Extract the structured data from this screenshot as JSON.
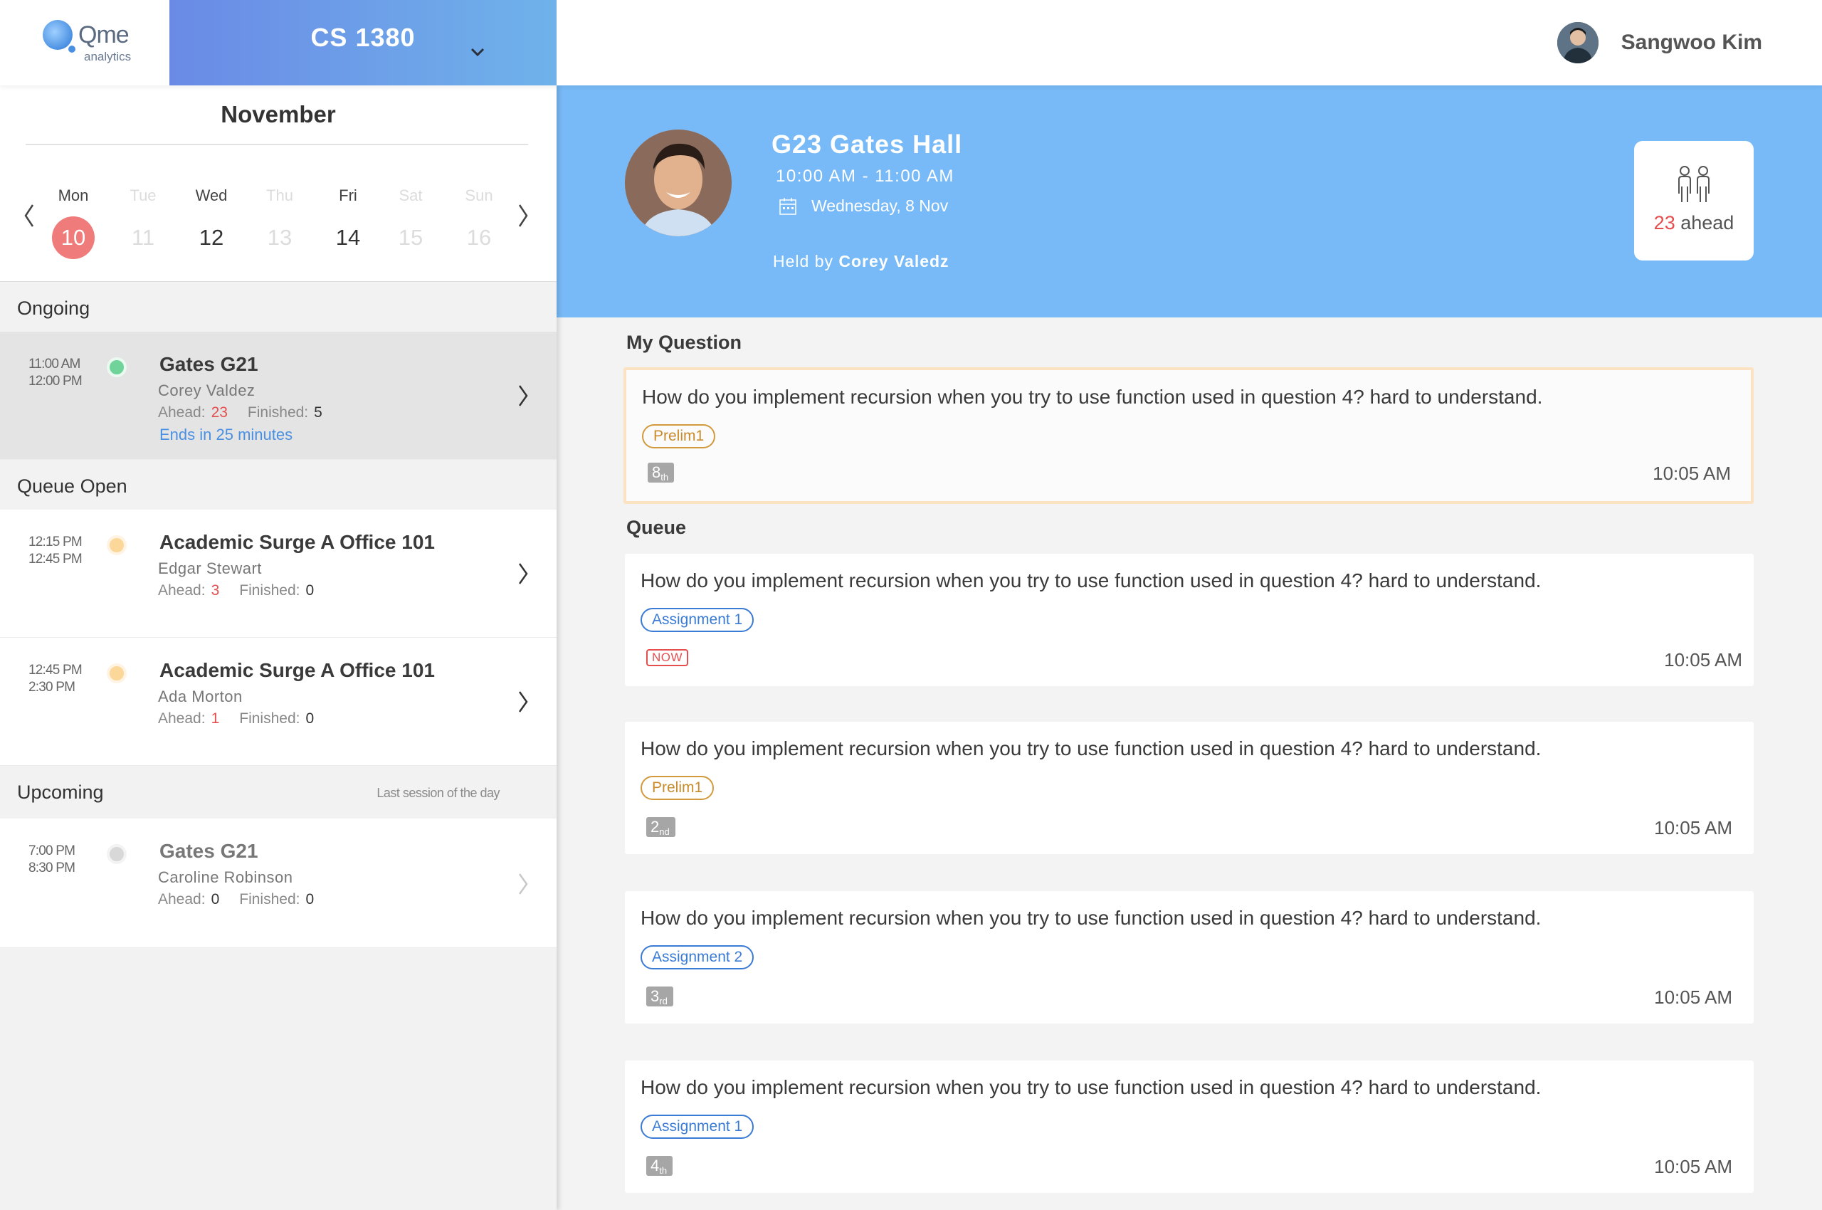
{
  "header": {
    "logo_text": "Qme",
    "logo_sub": "analytics",
    "course": "CS 1380",
    "user_name": "Sangwoo Kim"
  },
  "calendar": {
    "month": "November",
    "days": [
      {
        "name": "Mon",
        "date": "10",
        "state": "selected"
      },
      {
        "name": "Tue",
        "date": "11",
        "state": "disabled"
      },
      {
        "name": "Wed",
        "date": "12",
        "state": "normal"
      },
      {
        "name": "Thu",
        "date": "13",
        "state": "disabled"
      },
      {
        "name": "Fri",
        "date": "14",
        "state": "normal"
      },
      {
        "name": "Sat",
        "date": "15",
        "state": "disabled"
      },
      {
        "name": "Sun",
        "date": "16",
        "state": "disabled"
      }
    ]
  },
  "sections": {
    "ongoing": "Ongoing",
    "queue_open": "Queue Open",
    "upcoming": "Upcoming",
    "upcoming_note": "Last session of the day"
  },
  "labels": {
    "ahead": "Ahead:",
    "finished": "Finished:"
  },
  "sessions": [
    {
      "start": "11:00 AM",
      "end": "12:00 PM",
      "name": "Gates G21",
      "ta": "Corey Valdez",
      "ahead": "23",
      "finished": "5",
      "ends": "Ends in 25 minutes",
      "status": "ongoing",
      "status_color": "#6fd39a"
    },
    {
      "start": "12:15 PM",
      "end": "12:45 PM",
      "name": "Academic Surge A Office 101",
      "ta": "Edgar Stewart",
      "ahead": "3",
      "finished": "0",
      "status": "open",
      "status_color": "#fcd79a"
    },
    {
      "start": "12:45 PM",
      "end": "2:30 PM",
      "name": "Academic Surge A Office 101",
      "ta": "Ada Morton",
      "ahead": "1",
      "finished": "0",
      "status": "open",
      "status_color": "#fcd79a"
    },
    {
      "start": "7:00 PM",
      "end": "8:30 PM",
      "name": "Gates G21",
      "ta": "Caroline Robinson",
      "ahead": "0",
      "finished": "0",
      "status": "upcoming",
      "status_color": "#d8d8d8"
    }
  ],
  "current": {
    "room": "G23 Gates Hall",
    "time": "10:00 AM - 11:00 AM",
    "date": "Wednesday, 8 Nov",
    "held_prefix": "Held by",
    "held_by": "Corey Valedz",
    "ahead_count": "23",
    "ahead_label": "ahead"
  },
  "my_question": {
    "title": "My Question",
    "text": "How do you implement recursion when you try to use function used in question 4? hard to  understand.",
    "tag": "Prelim1",
    "position": "8",
    "position_suffix": "th",
    "time": "10:05 AM"
  },
  "queue": {
    "title": "Queue",
    "items": [
      {
        "text": "How do you implement recursion when you try to use function used in question 4? hard to  understand.",
        "tag": "Assignment 1",
        "tag_color": "blue",
        "badge": "NOW",
        "time": "10:05 AM"
      },
      {
        "text": "How do you implement recursion when you try to use function used in question 4? hard to  understand.",
        "tag": "Prelim1",
        "tag_color": "orange",
        "position": "2",
        "position_suffix": "nd",
        "time": "10:05 AM"
      },
      {
        "text": "How do you implement recursion when you try to use function used in question 4? hard to  understand.",
        "tag": "Assignment 2",
        "tag_color": "blue",
        "position": "3",
        "position_suffix": "rd",
        "time": "10:05 AM"
      },
      {
        "text": "How do you implement recursion when you try to use function used in question 4? hard to  understand.",
        "tag": "Assignment 1",
        "tag_color": "blue",
        "position": "4",
        "position_suffix": "th",
        "time": "10:05 AM"
      }
    ]
  },
  "colors": {
    "accent_blue": "#78baf7",
    "alert_red": "#e54e4e",
    "selected_day": "#f07b7b",
    "link_blue": "#4a90e2",
    "my_question_border": "#fbe2c2"
  }
}
